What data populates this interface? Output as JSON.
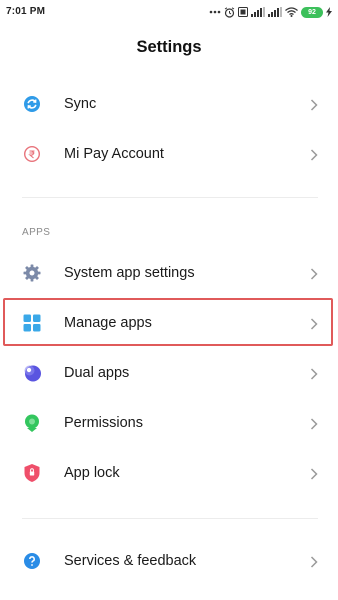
{
  "status_bar": {
    "time": "7:01 PM",
    "battery": "92"
  },
  "header": {
    "title": "Settings"
  },
  "top_group": [
    {
      "id": "sync",
      "label": "Sync",
      "icon": "sync-icon",
      "color": "#2f9be8"
    },
    {
      "id": "mi-pay-account",
      "label": "Mi Pay Account",
      "icon": "mi-pay-icon",
      "color": "#e8737b"
    }
  ],
  "apps_section": {
    "header": "APPS",
    "items": [
      {
        "id": "system-app-settings",
        "label": "System app settings",
        "icon": "gear-icon",
        "color": "#7c8aa8"
      },
      {
        "id": "manage-apps",
        "label": "Manage apps",
        "icon": "grid-icon",
        "color": "#3aa8e8",
        "highlighted": true
      },
      {
        "id": "dual-apps",
        "label": "Dual apps",
        "icon": "dual-apps-icon",
        "color": "#5a55e0"
      },
      {
        "id": "permissions",
        "label": "Permissions",
        "icon": "permissions-icon",
        "color": "#33c65e"
      },
      {
        "id": "app-lock",
        "label": "App lock",
        "icon": "lock-shield-icon",
        "color": "#ef4f6a"
      }
    ]
  },
  "bottom_group": [
    {
      "id": "services-feedback",
      "label": "Services & feedback",
      "icon": "help-icon",
      "color": "#2a8ce6"
    }
  ],
  "highlight_color": "#e05a5a"
}
